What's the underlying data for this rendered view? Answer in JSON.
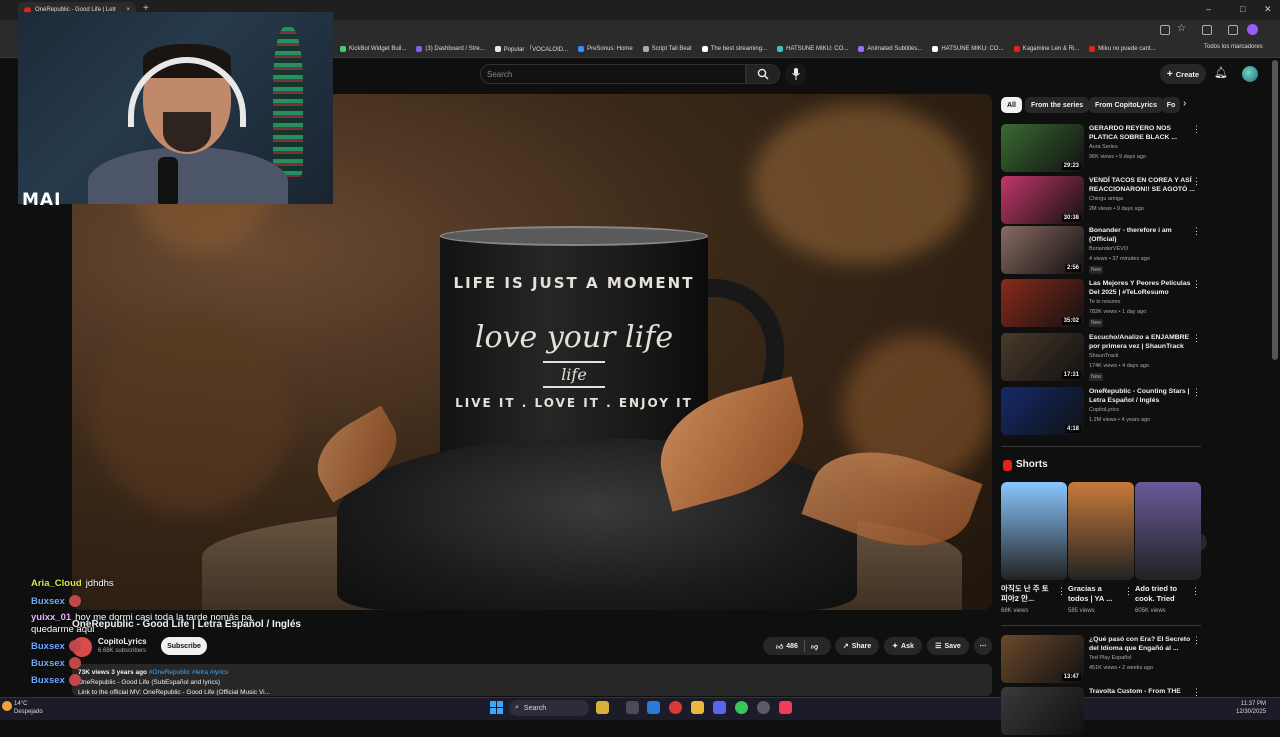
{
  "browser": {
    "tab_title": "OneRepublic - Good Life | Letr",
    "bookmarks": [
      {
        "label": "KickBot Widget Buil...",
        "color": "#3bd16f"
      },
      {
        "label": "(3) Dashboard / Stre...",
        "color": "#8a5cf6"
      },
      {
        "label": "Popular 「VOCALOID...",
        "color": "#e8e8e8"
      },
      {
        "label": "PreSonus: Home",
        "color": "#3a8cff"
      },
      {
        "label": "Script Tail Beat",
        "color": "#aaaaaa"
      },
      {
        "label": "The best streaming...",
        "color": "#ffffff"
      },
      {
        "label": "HATSUNE MIKU: CO...",
        "color": "#39c5bb"
      },
      {
        "label": "Animated Subtitles...",
        "color": "#9a6cff"
      },
      {
        "label": "HATSUNE MIKU: CO...",
        "color": "#ffffff"
      },
      {
        "label": "Kagamine Len & Ri...",
        "color": "#e62117"
      },
      {
        "label": "Miku no puede cant...",
        "color": "#e62117"
      }
    ],
    "bookmarks_folder": "Todos los marcadores"
  },
  "header": {
    "search_placeholder": "Search",
    "create_label": "Create"
  },
  "webcam": {
    "logo_text": "MAI"
  },
  "video": {
    "mug_line1": "LIFE IS JUST A MOMENT",
    "mug_line2": "love your life",
    "mug_line3": "life",
    "mug_line4": "LIVE IT . LOVE IT . ENJOY IT",
    "title": "OneRepublic - Good Life | Letra Español / Inglés",
    "channel_name": "CopitoLyrics",
    "channel_subs": "6.68K subscribers",
    "subscribe_label": "Subscribe",
    "like_count": "486",
    "share_label": "Share",
    "ask_label": "Ask",
    "save_label": "Save",
    "views": "73K views  3 years ago",
    "tags": "#OneRepublic #letra #lyrics",
    "desc_line2": "OneRepublic - Good Life (SubEspañol and lyrics)",
    "desc_line3": "Link to the official MV:  OneRepublic - Good Life (Official Music Vi..."
  },
  "chat": [
    {
      "user": "Aria_Cloud",
      "message": "jdhdhs",
      "color": "#d8e84a"
    },
    {
      "user": "Buxsex",
      "message": "",
      "color": "#6fa8ff"
    },
    {
      "user": "yuixx_01",
      "message": "hoy me dormi casi toda la tarde nomás pa",
      "color": "#e9b2ff"
    },
    {
      "user": "",
      "message": "quedarme aqui",
      "color": "#ffffff"
    },
    {
      "user": "Buxsex",
      "message": "",
      "color": "#6fa8ff"
    },
    {
      "user": "Buxsex",
      "message": "",
      "color": "#6fa8ff"
    },
    {
      "user": "Buxsex",
      "message": "",
      "color": "#6fa8ff"
    }
  ],
  "sidebar": {
    "chips": [
      "All",
      "From the series",
      "From CopitoLyrics",
      "Fo"
    ],
    "recommendations": [
      {
        "title": "GERARDO REYERO NOS PLATICA SOBRE BLACK ...",
        "channel": "Aura Series",
        "meta": "96K views • 9 days ago",
        "duration": "29:23",
        "badge": "",
        "color": "#3b6a32"
      },
      {
        "title": "VENDÍ TACOS EN COREA Y ASÍ REACCIONARON!! SE AGOTÓ ...",
        "channel": "Chingu amiga",
        "meta": "2M views • 9 days ago",
        "duration": "30:38",
        "badge": "",
        "color": "#c3376a"
      },
      {
        "title": "Bonander - therefore i am (Official)",
        "channel": "BonanderVEVO",
        "meta": "4 views • 37 minutes ago",
        "duration": "2:56",
        "badge": "New",
        "color": "#8a6a62"
      },
      {
        "title": "Las Mejores Y Peores Películas Del 2025 | #TeLoResumo",
        "channel": "Te lo resumo",
        "meta": "782K views • 1 day ago",
        "duration": "35:02",
        "badge": "New",
        "color": "#8a2a1a"
      },
      {
        "title": "Escucho/Analizo a ENJAMBRE por primera vez | ShaunTrack",
        "channel": "ShaunTrack",
        "meta": "174K views • 4 days ago",
        "duration": "17:31",
        "badge": "New",
        "color": "#4a3a2a"
      },
      {
        "title": "OneRepublic - Counting Stars | Letra Español / Inglés",
        "channel": "CopitoLyrics",
        "meta": "1.2M views • 4 years ago",
        "duration": "4:18",
        "badge": "",
        "color": "#142a6a"
      }
    ],
    "shorts_title": "Shorts",
    "shorts": [
      {
        "title": "아직도 난 주 토피아2 안...",
        "views": "68K views",
        "color": "#8ac6ff"
      },
      {
        "title": "Gracias a todos | YA ...",
        "views": "585 views",
        "color": "#c87a3a"
      },
      {
        "title": "Ado tried to cook. Tried",
        "views": "605K views",
        "color": "#6a5a9a"
      }
    ],
    "more": [
      {
        "title": "¿Qué pasó con Era? El Secreto del Idioma que Engañó al ...",
        "channel": "Ted Play Español",
        "meta": "451K views • 2 weeks ago",
        "duration": "13:47",
        "color": "#6a4a2a"
      },
      {
        "title": "Travolta Custom - From THE",
        "color": "#3a3a3a"
      }
    ]
  },
  "taskbar": {
    "temperature": "14°C",
    "weather": "Despejado",
    "search_label": "Search",
    "time": "11:37 PM",
    "date": "12/30/2025"
  }
}
